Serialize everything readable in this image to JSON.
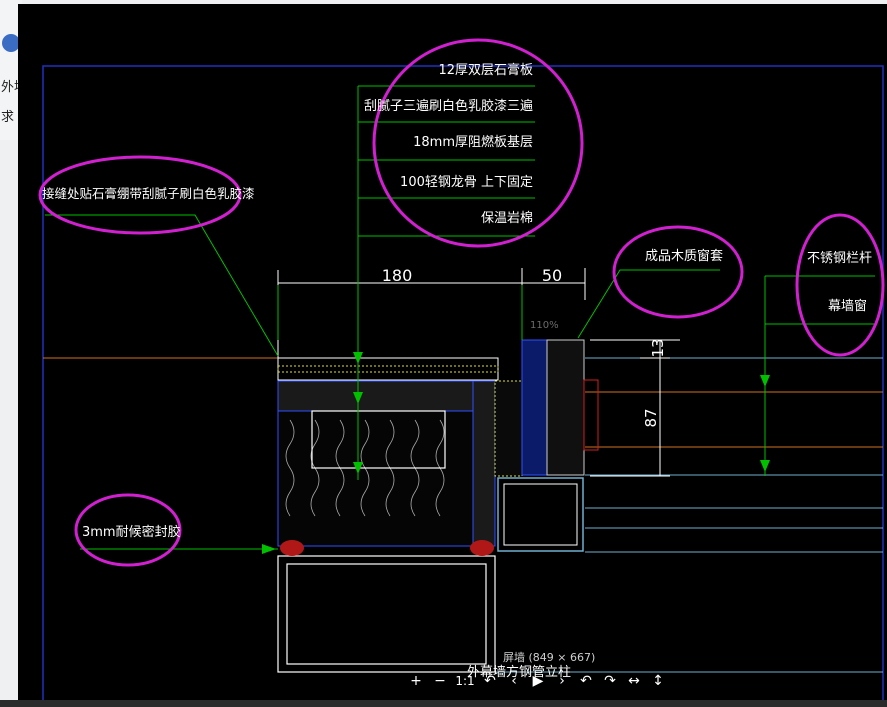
{
  "page_bg": {
    "left_text": [
      "外墙",
      "求"
    ]
  },
  "annotations": {
    "layer1": "12厚双层石膏板",
    "layer2": "刮腻子三遍刷白色乳胶漆三遍",
    "layer3": "18mm厚阻燃板基层",
    "layer4": "100轻钢龙骨 上下固定",
    "layer5": "保温岩棉",
    "joint_note": "接缝处贴石膏绷带刮腻子刷白色乳胶漆",
    "window_cover": "成品木质窗套",
    "railing": "不锈钢栏杆",
    "curtain_window": "幕墙窗",
    "sealant": "3mm耐候密封胶",
    "bottom_label": "外幕墙方钢管立柱"
  },
  "dimensions": {
    "d180": "180",
    "d50": "50",
    "d13": "13",
    "d87": "87"
  },
  "viewer": {
    "zoom": "110%",
    "info": "屏墙 (849 × 667)",
    "toolbar": {
      "zoom_in": "+",
      "zoom_out": "−",
      "one_to_one": "1:1",
      "rotate_left_icon": "↶",
      "prev": "‹",
      "play": "▶",
      "next": "›",
      "undo": "↶",
      "redo": "↷",
      "fit_width": "↔",
      "fit_height": "↕"
    }
  },
  "colors": {
    "highlight": "#d020d0",
    "leader": "#00c000",
    "frame": "#2030c0",
    "cad_blue": "#3050ff",
    "orange_line": "#d07020",
    "cyan_line": "#70b0d0",
    "sealant": "#c02020"
  }
}
